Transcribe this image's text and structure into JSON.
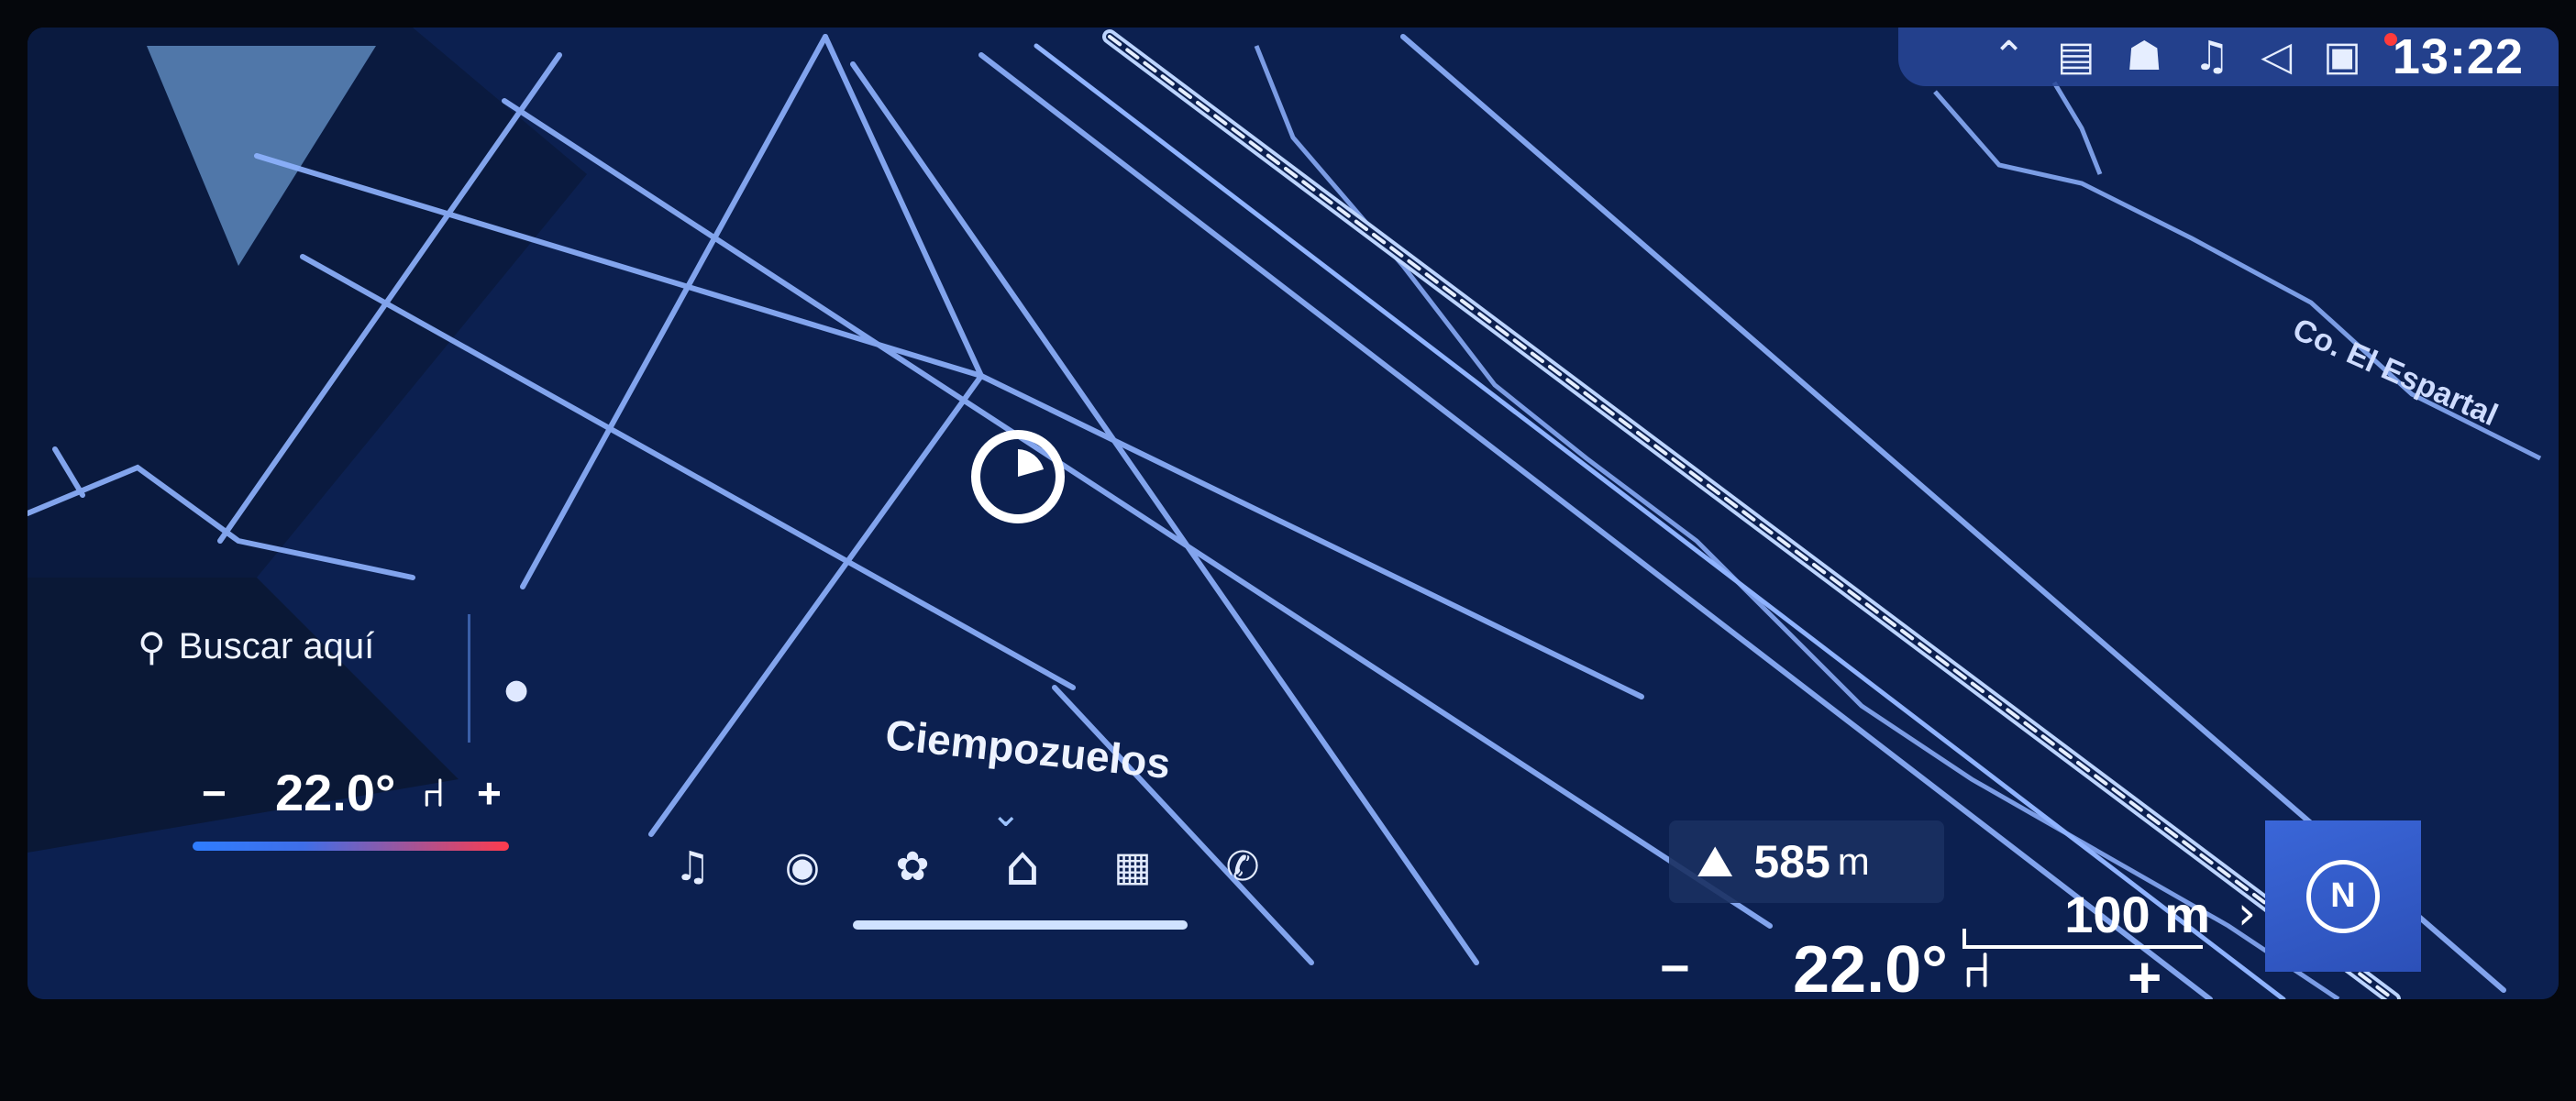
{
  "status_bar": {
    "time": "13:22",
    "icons": [
      "chevron-up-icon",
      "map-badge-icon",
      "driver-assist-icon",
      "music-note-icon",
      "volume-icon",
      "profile-icon"
    ],
    "notification_color": "#ff3b3b"
  },
  "search": {
    "label": "Buscar aquí"
  },
  "map": {
    "locality_label": "Ciempozuelos",
    "street_label": "Co. El Espartal",
    "background_color": "#0c2050",
    "road_color": "#8fb3ff"
  },
  "elevation": {
    "value": "585",
    "unit": "m"
  },
  "scale": {
    "label": "100 m"
  },
  "climate": {
    "left": {
      "minus": "−",
      "temperature": "22.0°",
      "plus": "+"
    },
    "right": {
      "minus": "−",
      "temperature": "22.0°",
      "plus": "+"
    }
  },
  "dock": {
    "items": [
      {
        "icon": "music-note-icon",
        "glyph": "♫"
      },
      {
        "icon": "media-disc-icon",
        "glyph": "◉"
      },
      {
        "icon": "fan-icon",
        "glyph": "✿"
      },
      {
        "icon": "home-icon",
        "glyph": "⌂"
      },
      {
        "icon": "apps-grid-icon",
        "glyph": "▦"
      },
      {
        "icon": "phone-icon",
        "glyph": "✆"
      }
    ],
    "active_item": "home-icon"
  },
  "compass": {
    "letter": "N"
  }
}
